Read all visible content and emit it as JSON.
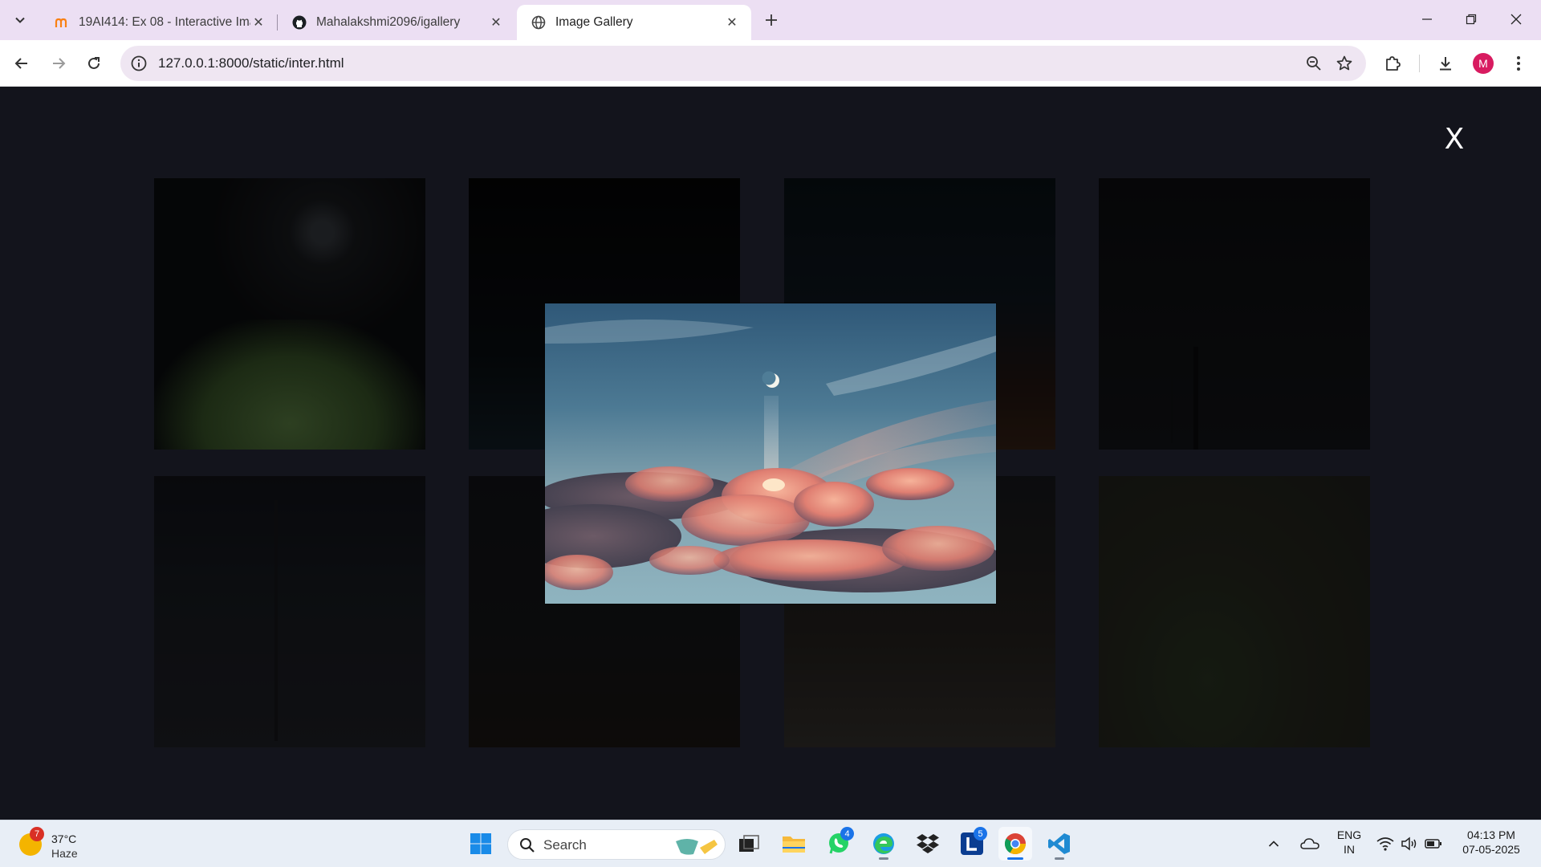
{
  "browser": {
    "tabs": [
      {
        "title": "19AI414: Ex 08 - Interactive Ima",
        "favicon": "moodle-icon",
        "active": false
      },
      {
        "title": "Mahalakshmi2096/igallery",
        "favicon": "github-icon",
        "active": false
      },
      {
        "title": "Image Gallery",
        "favicon": "globe-icon",
        "active": true
      }
    ],
    "url": "127.0.0.1:8000/static/inter.html",
    "profile_initial": "M"
  },
  "page": {
    "close_label": "X",
    "gallery_count": 8,
    "lightbox_subject": "crescent moon above pink sunset clouds"
  },
  "taskbar": {
    "weather": {
      "temp": "37°C",
      "condition": "Haze",
      "badge": "7"
    },
    "search_placeholder": "Search",
    "whatsapp_badge": "4",
    "app_l_badge": "5",
    "lang_line1": "ENG",
    "lang_line2": "IN",
    "time": "04:13 PM",
    "date": "07-05-2025"
  },
  "colors": {
    "tabstrip_bg": "#ecdff3",
    "page_bg": "#13141c",
    "taskbar_bg": "#e8eef6",
    "avatar_bg": "#d81b60",
    "accent": "#1a73e8"
  }
}
